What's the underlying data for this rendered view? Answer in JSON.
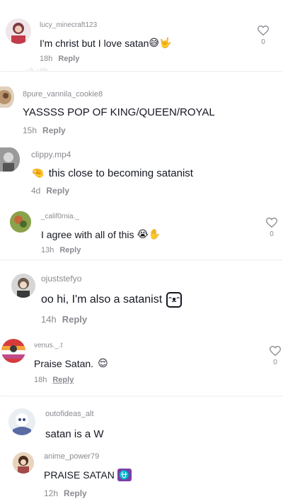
{
  "comments": [
    {
      "username": "lucy_minecraft123",
      "text": "I'm christ but I love satan",
      "emoji": "😅🤟",
      "time": "18h",
      "reply": "Reply",
      "likes": "0"
    },
    {
      "username": "8pure_vannila_cookie8",
      "text": "YASSSS POP OF KING/QUEEN/ROYAL",
      "time": "15h",
      "reply": "Reply"
    },
    {
      "username": "clippy.mp4",
      "emoji_prefix": "🤏",
      "text": "this close to becoming satanist",
      "time": "4d",
      "reply": "Reply"
    },
    {
      "username": "_calif0rnia._",
      "text": "I agree with all of this",
      "emoji": "😭✋",
      "time": "13h",
      "reply": "Reply",
      "likes": "0"
    },
    {
      "username": "ojuststefyo",
      "text": "oo hi, I'm also a satanist",
      "time": "14h",
      "reply": "Reply"
    },
    {
      "username": "venus._.t",
      "text": "Praise Satan.",
      "emoji": "😌",
      "time": "18h",
      "reply": "Reply",
      "likes": "0"
    },
    {
      "username": "outofideas_alt",
      "text": "satan is a W"
    },
    {
      "username": "anime_power79",
      "text": "PRAISE SATAN",
      "emoji": "⛎",
      "time": "12h",
      "reply": "Reply"
    }
  ],
  "colors": {
    "text": "#161823",
    "muted": "#8a8b91",
    "background": "#ffffff"
  }
}
